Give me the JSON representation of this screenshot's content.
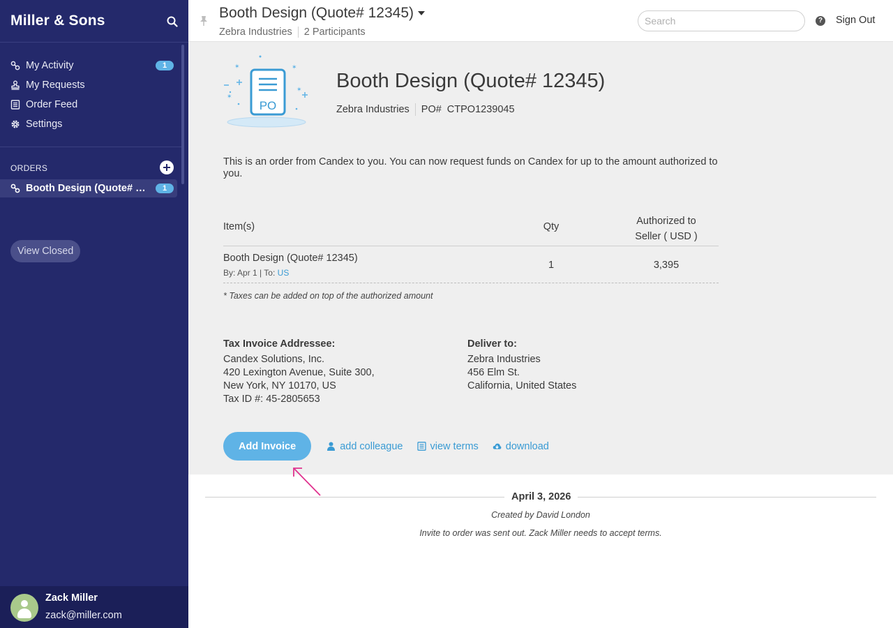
{
  "sidebar": {
    "brand": "Miller & Sons",
    "nav": [
      {
        "label": "My Activity",
        "icon": "link-icon",
        "badge": "1"
      },
      {
        "label": "My Requests",
        "icon": "stamp-icon"
      },
      {
        "label": "Order Feed",
        "icon": "document-icon"
      },
      {
        "label": "Settings",
        "icon": "gear-icon"
      }
    ],
    "orders_heading": "ORDERS",
    "orders": [
      {
        "label": "Booth Design (Quote# 12345)",
        "badge": "1",
        "icon": "link-icon"
      }
    ],
    "view_closed": "View Closed",
    "user": {
      "name": "Zack Miller",
      "email": "zack@miller.com"
    }
  },
  "topbar": {
    "title": "Booth Design (Quote# 12345)",
    "company": "Zebra Industries",
    "participants": "2 Participants",
    "search_placeholder": "Search",
    "help": "?",
    "sign_out": "Sign Out"
  },
  "order": {
    "title": "Booth Design (Quote# 12345)",
    "company": "Zebra Industries",
    "po_label": "PO#",
    "po_number": "CTPO1239045",
    "illustration_text": "PO",
    "intro": "This is an order from Candex to you. You can now request funds on Candex for up to the amount authorized to you.",
    "table": {
      "headers": {
        "item": "Item(s)",
        "qty": "Qty",
        "authorized_line1": "Authorized to",
        "authorized_line2": "Seller ( USD )"
      },
      "rows": [
        {
          "name": "Booth Design (Quote# 12345)",
          "by_label": "By:",
          "by": "Apr 1",
          "sep": "|",
          "to_label": "To:",
          "to": "US",
          "qty": "1",
          "amount": "3,395"
        }
      ]
    },
    "tax_note": "* Taxes can be added on top of the authorized amount",
    "invoice_addressee": {
      "label": "Tax Invoice Addressee:",
      "lines": [
        "Candex Solutions, Inc.",
        "420 Lexington Avenue, Suite 300,",
        "New York, NY 10170, US",
        "Tax ID #: 45-2805653"
      ]
    },
    "deliver_to": {
      "label": "Deliver to:",
      "lines": [
        "Zebra Industries",
        "456 Elm St.",
        "California, United States"
      ]
    },
    "actions": {
      "add_invoice": "Add Invoice",
      "add_colleague": "add colleague",
      "view_terms": "view terms",
      "download": "download"
    }
  },
  "timeline": {
    "date": "April 3, 2026",
    "created": "Created by David London",
    "event": "Invite to order was sent out. Zack Miller needs to accept terms."
  },
  "colors": {
    "sidebar_bg": "#24296b",
    "accent": "#5fb3e6",
    "link": "#3a9bd4",
    "annotation_arrow": "#e0338f"
  }
}
